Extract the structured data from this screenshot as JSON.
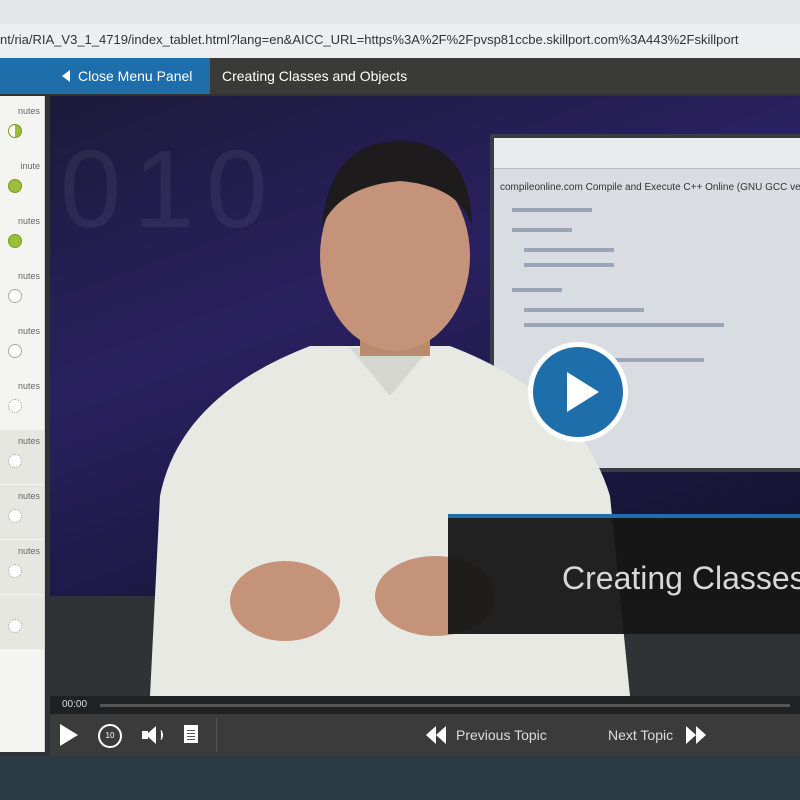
{
  "browser": {
    "url": "nt/ria/RIA_V3_1_4719/index_tablet.html?lang=en&AICC_URL=https%3A%2F%2Fpvsp81ccbe.skillport.com%3A443%2Fskillport"
  },
  "header": {
    "close_menu_label": "Close Menu Panel",
    "course_title": "Creating Classes and Objects"
  },
  "sidebar": {
    "items": [
      {
        "duration": "nutes",
        "status": "half"
      },
      {
        "duration": "inute",
        "status": "complete"
      },
      {
        "duration": "nutes",
        "status": "complete"
      },
      {
        "duration": "nutes",
        "status": "empty"
      },
      {
        "duration": "nutes",
        "status": "empty"
      },
      {
        "duration": "nutes",
        "status": "dotted"
      },
      {
        "duration": "nutes",
        "status": "dotted"
      },
      {
        "duration": "nutes",
        "status": "dotted"
      },
      {
        "duration": "nutes",
        "status": "dotted"
      },
      {
        "duration": "",
        "status": "dotted"
      }
    ]
  },
  "video": {
    "background_digits": "010",
    "monitor_site": "compileonline.com   Compile and Execute C++ Online (GNU GCC version",
    "lower_third": "Creating Classes",
    "time": "00:00"
  },
  "controls": {
    "replay_label": "10",
    "previous_topic": "Previous Topic",
    "next_topic": "Next Topic"
  },
  "colors": {
    "accent": "#1e6eab",
    "complete": "#9bbf3a"
  }
}
